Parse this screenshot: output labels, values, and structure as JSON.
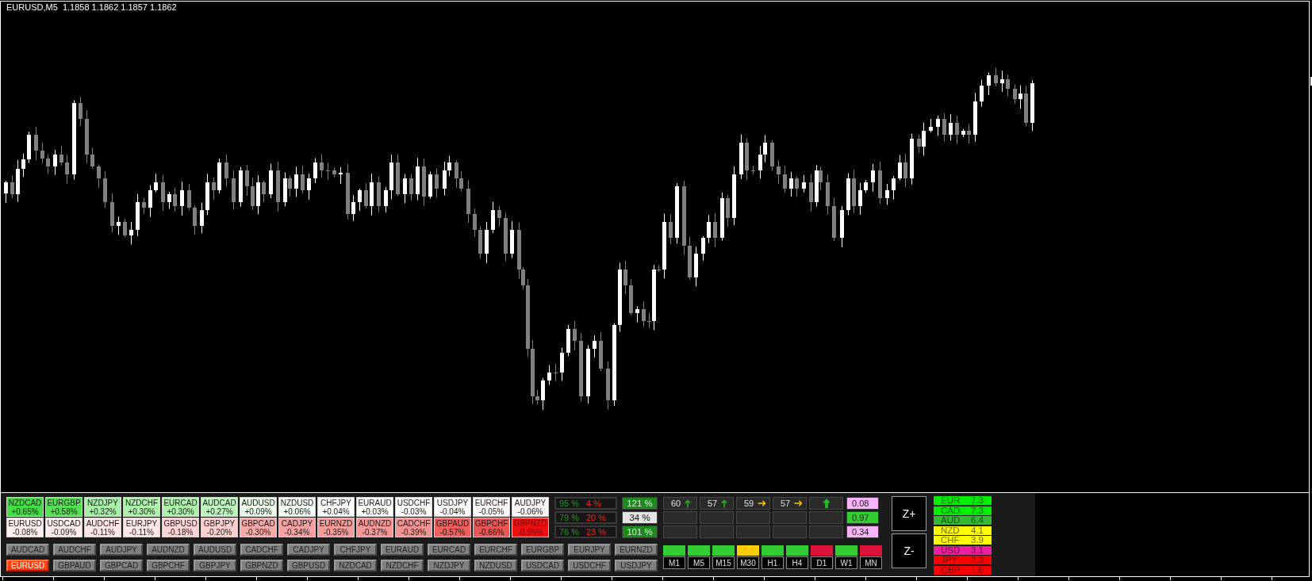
{
  "chart": {
    "title": "EURUSD,M5  1.1858 1.1862 1.1857 1.1862"
  },
  "pair_changes": [
    {
      "cells": [
        {
          "pair": "NZDCAD",
          "change": "+0.65%",
          "color": "#44dd44"
        },
        {
          "pair": "EURGBP",
          "change": "+0.58%",
          "color": "#55e055"
        },
        {
          "pair": "NZDJPY",
          "change": "+0.32%",
          "color": "#a8f0a8"
        },
        {
          "pair": "NZDCHF",
          "change": "+0.30%",
          "color": "#aef2ae"
        },
        {
          "pair": "EURCAD",
          "change": "+0.30%",
          "color": "#aef2ae"
        },
        {
          "pair": "AUDCAD",
          "change": "+0.27%",
          "color": "#bff5bf"
        },
        {
          "pair": "AUDUSD",
          "change": "+0.09%",
          "color": "#eafbea"
        },
        {
          "pair": "NZDUSD",
          "change": "+0.06%",
          "color": "#f4fdf4"
        },
        {
          "pair": "CHFJPY",
          "change": "+0.04%",
          "color": "#fbfefb"
        },
        {
          "pair": "EURAUD",
          "change": "+0.03%",
          "color": "#fcfffc"
        },
        {
          "pair": "USDCHF",
          "change": "-0.03%",
          "color": "#fffcfc"
        },
        {
          "pair": "USDJPY",
          "change": "-0.04%",
          "color": "#fffafa"
        },
        {
          "pair": "EURCHF",
          "change": "-0.05%",
          "color": "#fff8f8"
        },
        {
          "pair": "AUDJPY",
          "change": "-0.06%",
          "color": "#fff6f6"
        }
      ]
    },
    {
      "cells": [
        {
          "pair": "EURUSD",
          "change": "-0.08%",
          "color": "#ffeeee"
        },
        {
          "pair": "USDCAD",
          "change": "-0.09%",
          "color": "#ffeded"
        },
        {
          "pair": "AUDCHF",
          "change": "-0.11%",
          "color": "#ffe6e6"
        },
        {
          "pair": "EURJPY",
          "change": "-0.11%",
          "color": "#ffe6e6"
        },
        {
          "pair": "GBPUSD",
          "change": "-0.18%",
          "color": "#fdd3d3"
        },
        {
          "pair": "GBPJPY",
          "change": "-0.20%",
          "color": "#fccece"
        },
        {
          "pair": "GBPCAD",
          "change": "-0.30%",
          "color": "#f7a8a8"
        },
        {
          "pair": "CADJPY",
          "change": "-0.34%",
          "color": "#f5a0a0"
        },
        {
          "pair": "EURNZD",
          "change": "-0.35%",
          "color": "#f59b9b"
        },
        {
          "pair": "AUDNZD",
          "change": "-0.37%",
          "color": "#f49797"
        },
        {
          "pair": "CADCHF",
          "change": "-0.39%",
          "color": "#f39393"
        },
        {
          "pair": "GBPAUD",
          "change": "-0.57%",
          "color": "#ee6060"
        },
        {
          "pair": "GBPCHF",
          "change": "-0.66%",
          "color": "#ec5555"
        },
        {
          "pair": "GBPNZD",
          "change": "-0.96%",
          "color": "#ee1010"
        }
      ]
    }
  ],
  "percent_boxes": [
    {
      "positive": "95 %",
      "negative": "4 %"
    },
    {
      "positive": "79 %",
      "negative": "20 %"
    },
    {
      "positive": "76 %",
      "negative": "23 %"
    }
  ],
  "ratios": [
    {
      "value": "121 %",
      "color": "#1e8a1e"
    },
    {
      "value": "34 %",
      "color": "#e4e4e4"
    },
    {
      "value": "101 %",
      "color": "#1e8a1e"
    }
  ],
  "indicator_rows": [
    {
      "cells": [
        {
          "kind": "reading",
          "value": "60",
          "rising": true
        },
        {
          "kind": "reading",
          "value": "57",
          "rising": true
        },
        {
          "kind": "reading",
          "value": "59",
          "rising": false
        },
        {
          "kind": "reading",
          "value": "57",
          "rising": false
        },
        {
          "kind": "summary",
          "rising": true
        }
      ],
      "value": "0.08",
      "color": "#f8b4f8"
    },
    {
      "cells": [
        {
          "kind": "empty"
        },
        {
          "kind": "empty"
        },
        {
          "kind": "empty"
        },
        {
          "kind": "empty"
        },
        {
          "kind": "empty"
        }
      ],
      "value": "0.97",
      "color": "#33cc33"
    },
    {
      "cells": [
        {
          "kind": "empty"
        },
        {
          "kind": "empty"
        },
        {
          "kind": "empty"
        },
        {
          "kind": "empty"
        },
        {
          "kind": "empty"
        }
      ],
      "value": "0.34",
      "color": "#f8b4f8"
    }
  ],
  "timeframes": [
    {
      "label": "M1",
      "color": "#33cc33"
    },
    {
      "label": "M5",
      "color": "#33cc33"
    },
    {
      "label": "M15",
      "color": "#33cc33"
    },
    {
      "label": "M30",
      "color": "#ffcc00"
    },
    {
      "label": "H1",
      "color": "#33cc33"
    },
    {
      "label": "H4",
      "color": "#33cc33"
    },
    {
      "label": "D1",
      "color": "#dc143c"
    },
    {
      "label": "W1",
      "color": "#33cc33"
    },
    {
      "label": "MN",
      "color": "#dc143c"
    }
  ],
  "zoom_buttons": [
    "Z+",
    "Z-"
  ],
  "pair_buttons": [
    {
      "label": "AUDCAD",
      "selected": false
    },
    {
      "label": "AUDCHF",
      "selected": false
    },
    {
      "label": "AUDJPY",
      "selected": false
    },
    {
      "label": "AUDNZD",
      "selected": false
    },
    {
      "label": "AUDUSD",
      "selected": false
    },
    {
      "label": "CADCHF",
      "selected": false
    },
    {
      "label": "CADJPY",
      "selected": false
    },
    {
      "label": "CHFJPY",
      "selected": false
    },
    {
      "label": "EURAUD",
      "selected": false
    },
    {
      "label": "EURCAD",
      "selected": false
    },
    {
      "label": "EURCHF",
      "selected": false
    },
    {
      "label": "EURGBP",
      "selected": false
    },
    {
      "label": "EURJPY",
      "selected": false
    },
    {
      "label": "EURNZD",
      "selected": false
    },
    {
      "label": "EURUSD",
      "selected": true
    },
    {
      "label": "GBPAUD",
      "selected": false
    },
    {
      "label": "GBPCAD",
      "selected": false
    },
    {
      "label": "GBPCHF",
      "selected": false
    },
    {
      "label": "GBPJPY",
      "selected": false
    },
    {
      "label": "GBPNZD",
      "selected": false
    },
    {
      "label": "GBPUSD",
      "selected": false
    },
    {
      "label": "NZDCAD",
      "selected": false
    },
    {
      "label": "NZDCHF",
      "selected": false
    },
    {
      "label": "NZDJPY",
      "selected": false
    },
    {
      "label": "NZDUSD",
      "selected": false
    },
    {
      "label": "USDCAD",
      "selected": false
    },
    {
      "label": "USDCHF",
      "selected": false
    },
    {
      "label": "USDJPY",
      "selected": false
    }
  ],
  "currency_strength": [
    {
      "currency": "EUR",
      "value": "7.3",
      "color": "#00ee00"
    },
    {
      "currency": "CAD",
      "value": "7.3",
      "color": "#00ee00"
    },
    {
      "currency": "AUD",
      "value": "6.4",
      "color": "#33bb33"
    },
    {
      "currency": "NZD",
      "value": "4.1",
      "color": "#ffff00"
    },
    {
      "currency": "CHF",
      "value": "3.9",
      "color": "#ffff00"
    },
    {
      "currency": "USD",
      "value": "3.1",
      "color": "#ee1fa0"
    },
    {
      "currency": "JPY",
      "value": "2.3",
      "color": "#ff0000"
    },
    {
      "currency": "GBP",
      "value": "1.6",
      "color": "#ff0000"
    }
  ]
}
